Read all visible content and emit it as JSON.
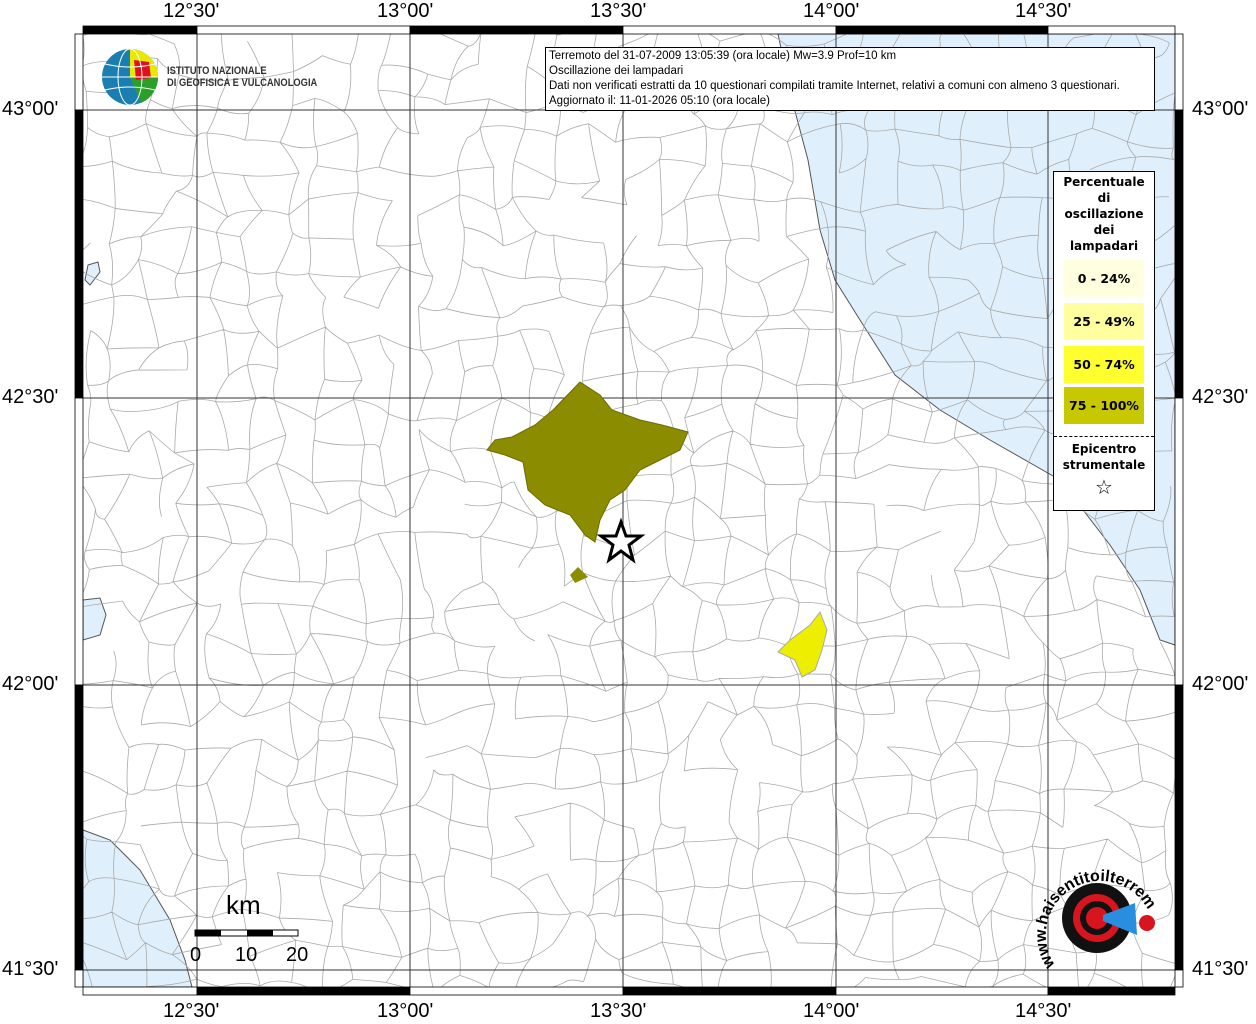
{
  "info": {
    "line1": "Terremoto del 31-07-2009 13:05:39 (ora locale) Mw=3.9 Prof=10 km",
    "line2": "Oscillazione dei lampadari",
    "line3": "Dati non verificati estratti da 10 questionari compilati tramite Internet, relativi a comuni con almeno 3 questionari.",
    "line4": "Aggiornato il: 11-01-2026 05:10 (ora locale)"
  },
  "axes": {
    "lon": [
      "12°30'",
      "13°00'",
      "13°30'",
      "14°00'",
      "14°30'"
    ],
    "lat": [
      "43°00'",
      "42°30'",
      "42°00'",
      "41°30'"
    ]
  },
  "legend": {
    "title": "Percentuale di oscillazione dei lampadari",
    "classes": [
      {
        "label": "0 - 24%",
        "color": "#ffffe0"
      },
      {
        "label": "25 - 49%",
        "color": "#ffffa0"
      },
      {
        "label": "50 - 74%",
        "color": "#ffff30"
      },
      {
        "label": "75 - 100%",
        "color": "#c8c800"
      }
    ],
    "epicenter": "Epicentro strumentale",
    "star": "☆"
  },
  "scale": {
    "unit": "km",
    "ticks": [
      "0",
      "10",
      "20"
    ]
  },
  "logos": {
    "ingv_line1": "ISTITUTO NAZIONALE",
    "ingv_line2": "DI GEOFISICA E VULCANOLOGIA",
    "hst": "www.haisentitoilterremoto.it"
  },
  "colors": {
    "sea": "#dff0fc",
    "olive": "#8c8c00",
    "yellow": "#eeee00"
  }
}
